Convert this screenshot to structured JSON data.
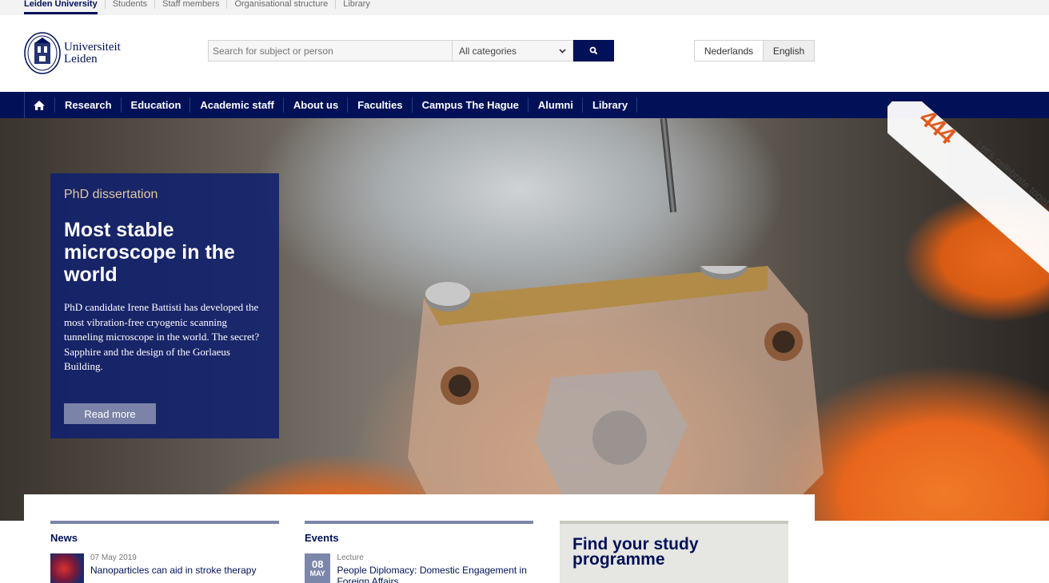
{
  "topbar": {
    "items": [
      "Leiden University",
      "Students",
      "Staff members",
      "Organisational structure",
      "Library"
    ]
  },
  "header": {
    "logo_line1": "Universiteit",
    "logo_line2": "Leiden",
    "search_placeholder": "Search for subject or person",
    "category_value": "All categories",
    "lang_nl": "Nederlands",
    "lang_en": "English"
  },
  "nav": {
    "items": [
      "Research",
      "Education",
      "Academic staff",
      "About us",
      "Faculties",
      "Campus The Hague",
      "Alumni",
      "Library"
    ]
  },
  "ribbon": {
    "number": "444",
    "text": "Let's celebrate toget"
  },
  "hero": {
    "kicker": "PhD dissertation",
    "title": "Most stable microscope in the world",
    "text": "PhD candidate Irene Battisti has developed the most vibration-free cryogenic scanning tunneling microscope in the world. The secret? Sapphire and the design of the Gorlaeus Building.",
    "button": "Read more"
  },
  "news": {
    "heading": "News",
    "date": "07 May 2019",
    "headline": "Nanoparticles can aid in stroke therapy"
  },
  "events": {
    "heading": "Events",
    "day": "08",
    "month": "MAY",
    "type": "Lecture",
    "headline": "People Diplomacy: Domestic Engagement in Foreign Affairs"
  },
  "study": {
    "heading": "Find your study programme"
  },
  "colors": {
    "brand_navy": "#001158",
    "accent_orange": "#e05a1e",
    "muted_blue": "#7c86a8"
  }
}
